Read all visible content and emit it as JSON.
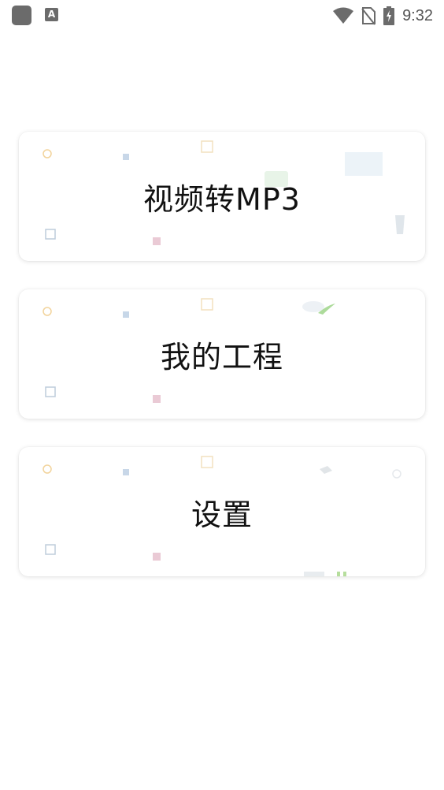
{
  "status_bar": {
    "time": "9:32",
    "icons": [
      "app-square-icon",
      "keyboard-a-icon",
      "wifi-icon",
      "no-sim-icon",
      "battery-charging-icon"
    ]
  },
  "menu": {
    "items": [
      {
        "label": "视频转MP3"
      },
      {
        "label": "我的工程"
      },
      {
        "label": "设置"
      }
    ]
  },
  "colors": {
    "background": "#ffffff",
    "card": "#ffffff",
    "text": "#111111",
    "status_icons": "#6b6b6b"
  }
}
